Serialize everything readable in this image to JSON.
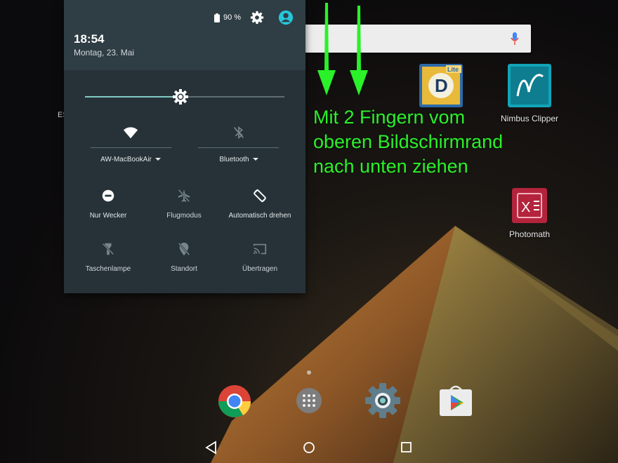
{
  "status": {
    "battery_percent": "90 %",
    "time": "18:54",
    "date": "Montag, 23. Mai"
  },
  "quick_settings": {
    "brightness_level": 0.48,
    "wifi": {
      "label": "AW-MacBookAir",
      "icon": "wifi-icon"
    },
    "bluetooth": {
      "label": "Bluetooth",
      "icon": "bluetooth-off-icon"
    },
    "tiles": [
      {
        "label": "Nur Wecker",
        "icon": "do-not-disturb-icon"
      },
      {
        "label": "Flugmodus",
        "icon": "airplane-icon"
      },
      {
        "label": "Automatisch drehen",
        "icon": "auto-rotate-icon"
      },
      {
        "label": "Taschenlampe",
        "icon": "flashlight-off-icon"
      },
      {
        "label": "Standort",
        "icon": "location-off-icon"
      },
      {
        "label": "Übertragen",
        "icon": "cast-icon"
      }
    ]
  },
  "home": {
    "apps": [
      {
        "label": "Ex...exp...",
        "icon": "app-lite-icon"
      },
      {
        "label": "Nimbus Clipper",
        "icon": "nimbus-clipper-icon"
      },
      {
        "label": "Photomath",
        "icon": "photomath-icon"
      }
    ],
    "partial_label": "ES",
    "dock": [
      "chrome-icon",
      "app-drawer-icon",
      "settings-app-icon",
      "play-store-icon"
    ]
  },
  "annotation": {
    "lines": [
      "Mit 2 Fingern vom",
      "oberen Bildschirmrand",
      "nach unten ziehen"
    ],
    "color": "#2af12a"
  },
  "colors": {
    "accent": "#80cbc4",
    "shade_bg": "#263238",
    "header_bg": "#2f3d44"
  }
}
